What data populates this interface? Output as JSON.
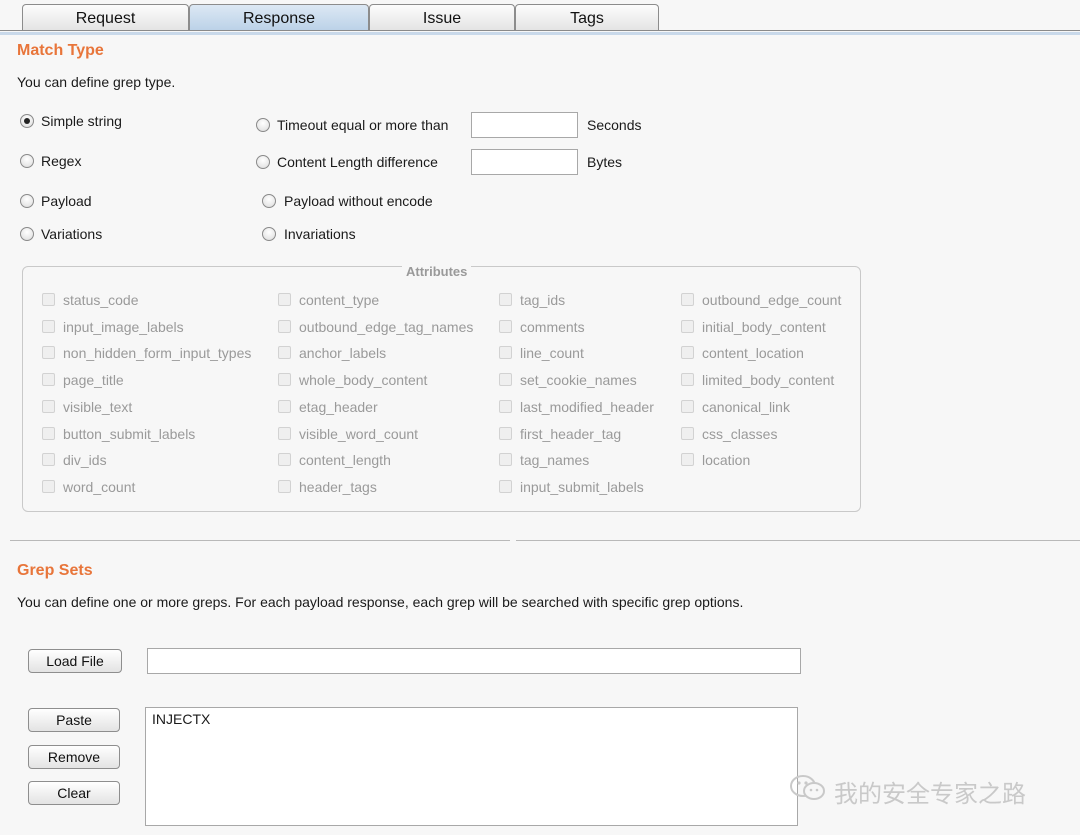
{
  "tabs": [
    "Request",
    "Response",
    "Issue",
    "Tags"
  ],
  "active_tab": "Response",
  "match_type": {
    "title": "Match Type",
    "description": "You can define grep type.",
    "options": {
      "simple_string": "Simple string",
      "regex": "Regex",
      "payload": "Payload",
      "variations": "Variations",
      "timeout": "Timeout equal or more than",
      "content_length": "Content Length difference",
      "payload_without_encode": "Payload without encode",
      "invariations": "Invariations"
    },
    "selected": "simple_string",
    "timeout_value": "",
    "timeout_unit": "Seconds",
    "content_length_value": "",
    "content_length_unit": "Bytes"
  },
  "attributes": {
    "title": "Attributes",
    "columns": [
      [
        "status_code",
        "input_image_labels",
        "non_hidden_form_input_types",
        "page_title",
        "visible_text",
        "button_submit_labels",
        "div_ids",
        "word_count"
      ],
      [
        "content_type",
        "outbound_edge_tag_names",
        "anchor_labels",
        "whole_body_content",
        "etag_header",
        "visible_word_count",
        "content_length",
        "header_tags"
      ],
      [
        "tag_ids",
        "comments",
        "line_count",
        "set_cookie_names",
        "last_modified_header",
        "first_header_tag",
        "tag_names",
        "input_submit_labels"
      ],
      [
        "outbound_edge_count",
        "initial_body_content",
        "content_location",
        "limited_body_content",
        "canonical_link",
        "css_classes",
        "location"
      ]
    ]
  },
  "grep_sets": {
    "title": "Grep Sets",
    "description": "You can define one or more greps. For each payload response, each grep will be searched with specific grep options.",
    "load_file_label": "Load File",
    "file_path": "",
    "paste_label": "Paste",
    "remove_label": "Remove",
    "clear_label": "Clear",
    "greps_text": "INJECTX"
  },
  "watermark": "我的安全专家之路",
  "colors": {
    "section_title": "#e8753a",
    "active_tab": "#c6d8ec"
  }
}
